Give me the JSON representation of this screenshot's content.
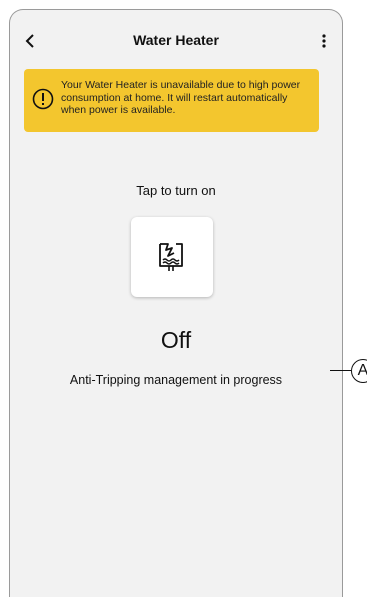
{
  "header": {
    "title": "Water Heater",
    "back_icon": "chevron-left-icon",
    "more_icon": "more-vertical-icon"
  },
  "banner": {
    "icon": "warning-icon",
    "message": "Your Water Heater is unavailable due to high power consumption at home. It will restart automatically when power is available.",
    "color": "#f3c62e"
  },
  "control": {
    "prompt": "Tap to turn on",
    "icon": "water-heater-unavailable-icon",
    "state": "Off",
    "note": "Anti-Tripping management in progress"
  },
  "callout": {
    "label": "A"
  }
}
